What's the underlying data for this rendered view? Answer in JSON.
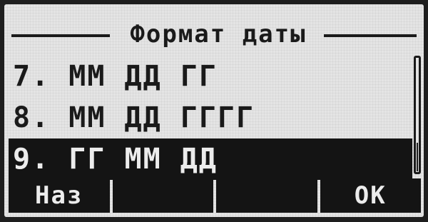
{
  "screen": {
    "title": "Формат даты"
  },
  "list": {
    "items": [
      {
        "label": "7. ММ ДД ГГ",
        "selected": false
      },
      {
        "label": "8. ММ ДД ГГГГ",
        "selected": false
      },
      {
        "label": "9. ГГ ММ ДД",
        "selected": true
      }
    ],
    "scroll_position": "bottom"
  },
  "softkeys": [
    {
      "label": "Наз"
    },
    {
      "label": ""
    },
    {
      "label": ""
    },
    {
      "label": "ОК"
    }
  ]
}
